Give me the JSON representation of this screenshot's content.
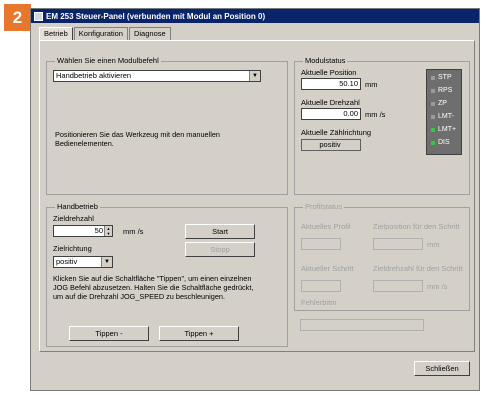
{
  "step_number": "2",
  "window": {
    "title": "EM 253 Steuer-Panel (verbunden mit Modul an Position 0)"
  },
  "tabs": [
    {
      "label": "Betrieb"
    },
    {
      "label": "Konfiguration"
    },
    {
      "label": "Diagnose"
    }
  ],
  "mode_group": {
    "label": "Wählen Sie einen Modulbefehl",
    "selected": "Handbetrieb aktivieren",
    "description": "Positionieren Sie das Werkzeug mit den manuellen Bedienelementen."
  },
  "status_group": {
    "label": "Modulstatus",
    "position_label": "Aktuelle Position",
    "position_value": "50.10",
    "position_unit": "mm",
    "speed_label": "Aktuelle Drehzahl",
    "speed_value": "0.00",
    "speed_unit": "mm /s",
    "direction_label": "Aktuelle Zählrichtung",
    "direction_value": "positiv",
    "leds": [
      {
        "label": "STP",
        "color": "#9a9a9a"
      },
      {
        "label": "RPS",
        "color": "#9a9a9a"
      },
      {
        "label": "ZP",
        "color": "#9a9a9a"
      },
      {
        "label": "LMT-",
        "color": "#9a9a9a"
      },
      {
        "label": "LMT+",
        "color": "#2ecc40"
      },
      {
        "label": "DIS",
        "color": "#2ecc40"
      }
    ]
  },
  "manual_group": {
    "label": "Handbetrieb",
    "speed_label": "Zieldrehzahl",
    "speed_value": "50",
    "speed_unit": "mm /s",
    "direction_label": "Zielrichtung",
    "direction_value": "positiv",
    "start_label": "Start",
    "stop_label": "Stopp",
    "help_text": "Klicken Sie auf die Schaltfläche \"Tippen\", um einen einzelnen JOG Befehl abzusetzen. Halten Sie die Schaltfläche gedrückt, um auf die Drehzahl JOG_SPEED zu beschleunigen.",
    "jog_minus_label": "Tippen -",
    "jog_plus_label": "Tippen +"
  },
  "profile_group": {
    "label": "Profilstatus",
    "profile_label": "Aktuelles Profil",
    "step_label": "Aktueller Schritt",
    "target_pos_label": "Zielposition für den Schritt",
    "target_pos_unit": "mm",
    "target_speed_label": "Zieldrehzahl für den Schritt",
    "target_speed_unit": "mm /s",
    "error_label": "Fehlerbitm"
  },
  "close_label": "Schließen"
}
